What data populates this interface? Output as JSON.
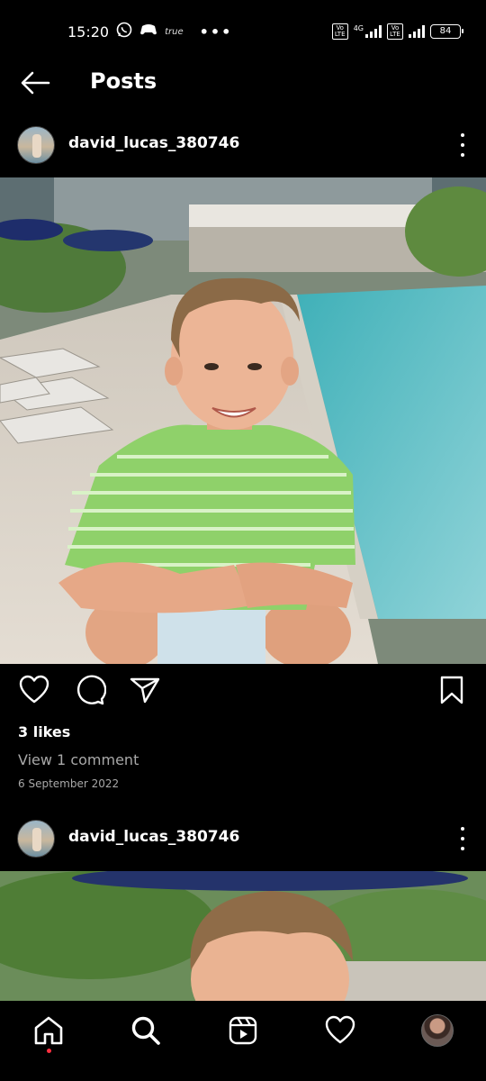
{
  "status_bar": {
    "time": "15:20",
    "app_label": "true",
    "overflow": "•••",
    "sim1_label": "Vo\nLTE",
    "sim1_network": "4G",
    "sim2_label": "Vo\nLTE",
    "battery": "84",
    "icons": [
      "whatsapp-icon",
      "game-icon",
      "truecaller-icon",
      "signal-icon",
      "battery-icon"
    ]
  },
  "header": {
    "title": "Posts",
    "back_icon": "arrow-left-icon"
  },
  "posts": [
    {
      "username": "david_lucas_380746",
      "likes": "3 likes",
      "comments_link": "View 1 comment",
      "date": "6 September 2022"
    },
    {
      "username": "david_lucas_380746"
    }
  ],
  "actions": {
    "icons": [
      "heart-icon",
      "comment-icon",
      "share-icon",
      "bookmark-icon"
    ]
  },
  "bottom_nav": {
    "items": [
      "home-icon",
      "search-icon",
      "reels-icon",
      "heart-icon",
      "profile-avatar"
    ],
    "notification_color": "#ff3040"
  },
  "colors": {
    "background": "#000000",
    "secondary_text": "#a8a8a8"
  }
}
